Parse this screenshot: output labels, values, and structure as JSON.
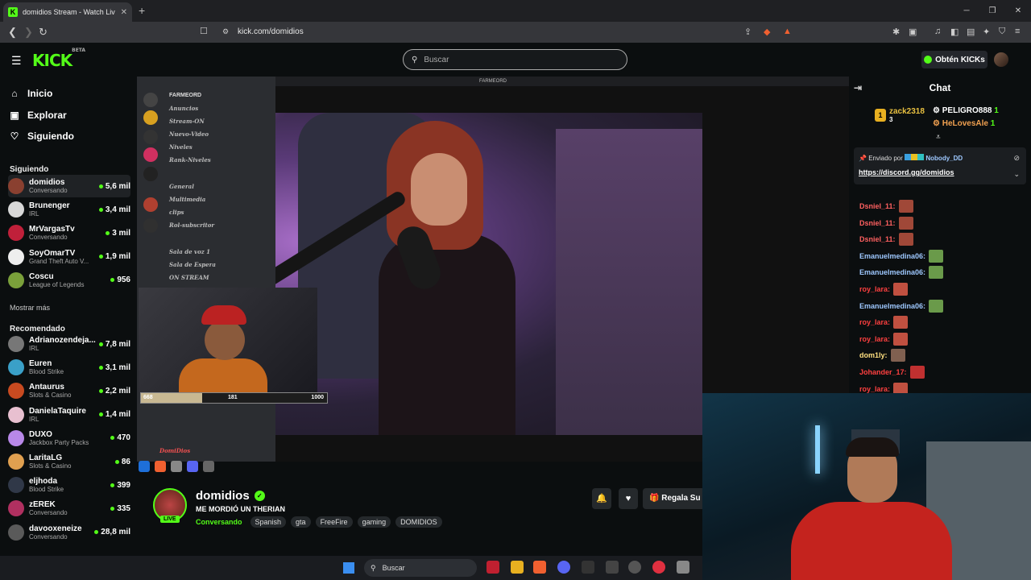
{
  "browser": {
    "tab_title": "domidios Stream - Watch Liv",
    "tab_favicon": "K",
    "url": "kick.com/domidios"
  },
  "header": {
    "logo": "KICK",
    "logo_badge": "BETA",
    "search_placeholder": "Buscar",
    "get_kicks": "Obtén KICKs"
  },
  "sidebar": {
    "nav": [
      {
        "label": "Inicio",
        "icon": "home-icon"
      },
      {
        "label": "Explorar",
        "icon": "compass-icon"
      },
      {
        "label": "Siguiendo",
        "icon": "heart-icon"
      }
    ],
    "following_title": "Siguiendo",
    "following": [
      {
        "name": "domidios",
        "category": "Conversando",
        "viewers": "5,6 mil",
        "color": "#8a4030"
      },
      {
        "name": "Brunenger",
        "category": "IRL",
        "viewers": "3,4 mil",
        "color": "#d8d8d8"
      },
      {
        "name": "MrVargasTv",
        "category": "Conversando",
        "viewers": "3 mil",
        "color": "#c0203a"
      },
      {
        "name": "SoyOmarTV",
        "category": "Grand Theft Auto V...",
        "viewers": "1,9 mil",
        "color": "#eeeeee"
      },
      {
        "name": "Coscu",
        "category": "League of Legends",
        "viewers": "956",
        "color": "#7aa03a"
      }
    ],
    "show_more": "Mostrar más",
    "recommended_title": "Recomendado",
    "recommended": [
      {
        "name": "Adrianozendeja...",
        "category": "IRL",
        "viewers": "7,8 mil",
        "color": "#777777"
      },
      {
        "name": "Euren",
        "category": "Blood Strike",
        "viewers": "3,1 mil",
        "color": "#3aa0c8"
      },
      {
        "name": "Antaurus",
        "category": "Slots & Casino",
        "viewers": "2,2 mil",
        "color": "#c84a20"
      },
      {
        "name": "DanielaTaquire",
        "category": "IRL",
        "viewers": "1,4 mil",
        "color": "#e8c0d0"
      },
      {
        "name": "DUXO",
        "category": "Jackbox Party Packs",
        "viewers": "470",
        "color": "#b888e8"
      },
      {
        "name": "LaritaLG",
        "category": "Slots & Casino",
        "viewers": "86",
        "color": "#e0a050"
      },
      {
        "name": "eljhoda",
        "category": "Blood Strike",
        "viewers": "399",
        "color": "#303848"
      },
      {
        "name": "zEREK",
        "category": "Conversando",
        "viewers": "335",
        "color": "#b03060"
      },
      {
        "name": "davooxeneize",
        "category": "Conversando",
        "viewers": "28,8 mil",
        "color": "#5a5a5a"
      }
    ]
  },
  "stream": {
    "discord_server": "FARMEORD",
    "discord_title_bar": "FARMEORD",
    "discord_channels": [
      "Anuncios",
      "Stream-ON",
      "Nuevo-Video",
      "Niveles",
      "Rank-Niveles",
      "General",
      "Multimedia",
      "clips",
      "Rol-subscritor",
      "Sala de voz 1",
      "Sala de Espera",
      "ON STREAM"
    ],
    "discord_user": "DomiDios",
    "goal_start": "668",
    "goal_label": "181",
    "goal_end": "1000",
    "goal_progress": 0.33
  },
  "chat": {
    "title": "Chat",
    "gifters": [
      {
        "rank": "1",
        "name": "zack2318",
        "count": "3"
      },
      {
        "rank": "",
        "name": "PELIGRO888",
        "count": "1"
      },
      {
        "rank": "",
        "name": "HeLovesAle",
        "count": "1"
      }
    ],
    "pinned_by_label": "Enviado por",
    "pinned_by": "Nobody_DD",
    "pinned_link": "https://discord.gg/domidios",
    "messages": [
      {
        "user": "Dsniel_11:",
        "color": "#ff6060",
        "emote": "#a04838"
      },
      {
        "user": "Dsniel_11:",
        "color": "#ff6060",
        "emote": "#a04838"
      },
      {
        "user": "Dsniel_11:",
        "color": "#ff6060",
        "emote": "#a04838"
      },
      {
        "user": "Emanuelmedina06:",
        "color": "#9ec8ff",
        "emote": "#6a9a4a"
      },
      {
        "user": "Emanuelmedina06:",
        "color": "#9ec8ff",
        "emote": "#6a9a4a"
      },
      {
        "user": "roy_lara:",
        "color": "#ff4040",
        "emote": "#c05040"
      },
      {
        "user": "Emanuelmedina06:",
        "color": "#9ec8ff",
        "emote": "#6a9a4a"
      },
      {
        "user": "roy_lara:",
        "color": "#ff4040",
        "emote": "#c05040"
      },
      {
        "user": "roy_lara:",
        "color": "#ff4040",
        "emote": "#c05040"
      },
      {
        "user": "dom1ly:",
        "color": "#ffe080",
        "emote": "#806050"
      },
      {
        "user": "Johander_17:",
        "color": "#ff4040",
        "emote": "#c03030"
      },
      {
        "user": "roy_lara:",
        "color": "#ff4040",
        "emote": "#c05040"
      }
    ]
  },
  "channel": {
    "name": "domidios",
    "live_label": "LIVE",
    "title": "ME MORDIÓ UN THERIAN",
    "category": "Conversando",
    "tags": [
      "Spanish",
      "gta",
      "FreeFire",
      "gaming",
      "DOMIDIOS"
    ],
    "gift_button": "Regala Su"
  },
  "taskbar": {
    "search": "Buscar"
  }
}
